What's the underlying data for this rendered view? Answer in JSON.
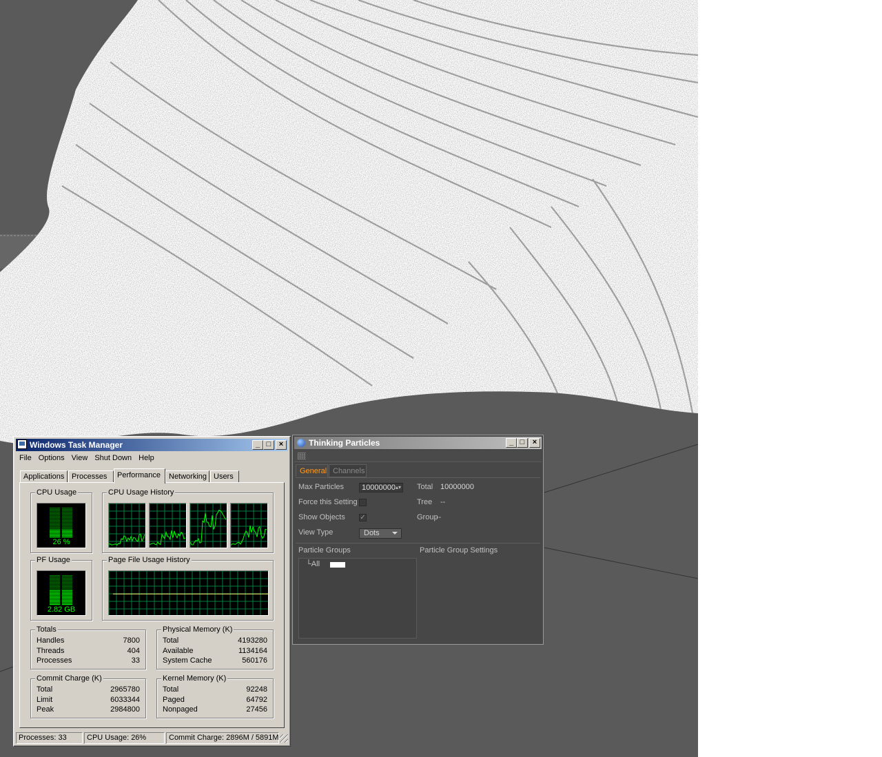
{
  "task_manager": {
    "title": "Windows Task Manager",
    "window_buttons": {
      "minimize": "_",
      "maximize": "□",
      "close": "×"
    },
    "menu": [
      "File",
      "Options",
      "View",
      "Shut Down",
      "Help"
    ],
    "tabs": [
      "Applications",
      "Processes",
      "Performance",
      "Networking",
      "Users"
    ],
    "active_tab": "Performance",
    "cpu_usage": {
      "label": "CPU Usage",
      "value_text": "26 %",
      "fraction": 0.26
    },
    "cpu_history": {
      "label": "CPU Usage History"
    },
    "pf_usage": {
      "label": "PF Usage",
      "value_text": "2.82 GB",
      "fraction": 0.48
    },
    "pf_history": {
      "label": "Page File Usage History"
    },
    "totals": {
      "label": "Totals",
      "rows": [
        {
          "k": "Handles",
          "v": "7800"
        },
        {
          "k": "Threads",
          "v": "404"
        },
        {
          "k": "Processes",
          "v": "33"
        }
      ]
    },
    "physical_memory": {
      "label": "Physical Memory (K)",
      "rows": [
        {
          "k": "Total",
          "v": "4193280"
        },
        {
          "k": "Available",
          "v": "1134164"
        },
        {
          "k": "System Cache",
          "v": "560176"
        }
      ]
    },
    "commit_charge": {
      "label": "Commit Charge (K)",
      "rows": [
        {
          "k": "Total",
          "v": "2965780"
        },
        {
          "k": "Limit",
          "v": "6033344"
        },
        {
          "k": "Peak",
          "v": "2984800"
        }
      ]
    },
    "kernel_memory": {
      "label": "Kernel Memory (K)",
      "rows": [
        {
          "k": "Total",
          "v": "92248"
        },
        {
          "k": "Paged",
          "v": "64792"
        },
        {
          "k": "Nonpaged",
          "v": "27456"
        }
      ]
    },
    "status": {
      "processes": "Processes: 33",
      "cpu": "CPU Usage: 26%",
      "commit": "Commit Charge: 2896M / 5891M"
    },
    "colors": {
      "graph_line": "#00ff00",
      "grid": "#008040",
      "titlebar_start": "#0a246a",
      "titlebar_end": "#a6caf0"
    }
  },
  "thinking_particles": {
    "title": "Thinking Particles",
    "tabs": [
      "General",
      "Channels"
    ],
    "active_tab": "General",
    "max_particles": {
      "label": "Max Particles",
      "value": "10000000"
    },
    "total": {
      "label": "Total",
      "value": "10000000"
    },
    "force_setting": {
      "label": "Force this Setting",
      "checked": false
    },
    "tree": {
      "label": "Tree",
      "value": "--"
    },
    "show_objects": {
      "label": "Show Objects",
      "checked": true,
      "mark": "✓"
    },
    "group": {
      "label": "Group",
      "value": "--"
    },
    "view_type": {
      "label": "View Type",
      "value": "Dots"
    },
    "particle_groups": {
      "label": "Particle Groups",
      "root": "└All",
      "root_color": "#ffffff"
    },
    "group_settings": {
      "label": "Particle Group Settings"
    },
    "colors": {
      "accent": "#ff9c21",
      "bg": "#474747"
    }
  }
}
